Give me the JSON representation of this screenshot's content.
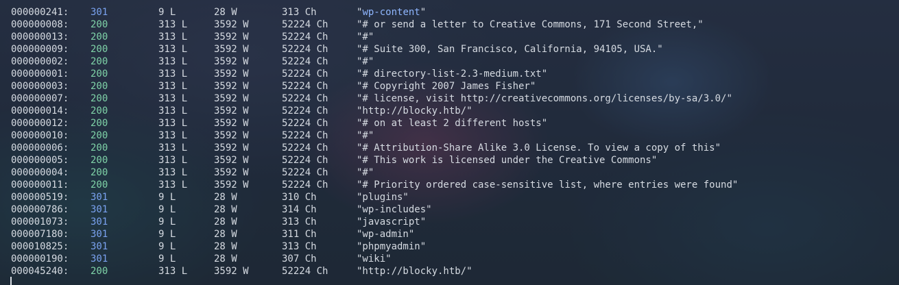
{
  "terminal": {
    "rows": [
      {
        "id": "000000241:",
        "status": "301",
        "lines": "9 L",
        "words": "28 W",
        "chars": "313 Ch",
        "payload_open": "\"",
        "payload_hl": "wp-content",
        "payload_close": "\""
      },
      {
        "id": "000000008:",
        "status": "200",
        "lines": "313 L",
        "words": "3592 W",
        "chars": "52224 Ch",
        "payload": "\"# or send a letter to Creative Commons, 171 Second Street,\""
      },
      {
        "id": "000000013:",
        "status": "200",
        "lines": "313 L",
        "words": "3592 W",
        "chars": "52224 Ch",
        "payload": "\"#\""
      },
      {
        "id": "000000009:",
        "status": "200",
        "lines": "313 L",
        "words": "3592 W",
        "chars": "52224 Ch",
        "payload": "\"# Suite 300, San Francisco, California, 94105, USA.\""
      },
      {
        "id": "000000002:",
        "status": "200",
        "lines": "313 L",
        "words": "3592 W",
        "chars": "52224 Ch",
        "payload": "\"#\""
      },
      {
        "id": "000000001:",
        "status": "200",
        "lines": "313 L",
        "words": "3592 W",
        "chars": "52224 Ch",
        "payload": "\"# directory-list-2.3-medium.txt\""
      },
      {
        "id": "000000003:",
        "status": "200",
        "lines": "313 L",
        "words": "3592 W",
        "chars": "52224 Ch",
        "payload": "\"# Copyright 2007 James Fisher\""
      },
      {
        "id": "000000007:",
        "status": "200",
        "lines": "313 L",
        "words": "3592 W",
        "chars": "52224 Ch",
        "payload": "\"# license, visit http://creativecommons.org/licenses/by-sa/3.0/\""
      },
      {
        "id": "000000014:",
        "status": "200",
        "lines": "313 L",
        "words": "3592 W",
        "chars": "52224 Ch",
        "payload": "\"http://blocky.htb/\""
      },
      {
        "id": "000000012:",
        "status": "200",
        "lines": "313 L",
        "words": "3592 W",
        "chars": "52224 Ch",
        "payload": "\"# on at least 2 different hosts\""
      },
      {
        "id": "000000010:",
        "status": "200",
        "lines": "313 L",
        "words": "3592 W",
        "chars": "52224 Ch",
        "payload": "\"#\""
      },
      {
        "id": "000000006:",
        "status": "200",
        "lines": "313 L",
        "words": "3592 W",
        "chars": "52224 Ch",
        "payload": "\"# Attribution-Share Alike 3.0 License. To view a copy of this\""
      },
      {
        "id": "000000005:",
        "status": "200",
        "lines": "313 L",
        "words": "3592 W",
        "chars": "52224 Ch",
        "payload": "\"# This work is licensed under the Creative Commons\""
      },
      {
        "id": "000000004:",
        "status": "200",
        "lines": "313 L",
        "words": "3592 W",
        "chars": "52224 Ch",
        "payload": "\"#\""
      },
      {
        "id": "000000011:",
        "status": "200",
        "lines": "313 L",
        "words": "3592 W",
        "chars": "52224 Ch",
        "payload": "\"# Priority ordered case-sensitive list, where entries were found\""
      },
      {
        "id": "000000519:",
        "status": "301",
        "lines": "9 L",
        "words": "28 W",
        "chars": "310 Ch",
        "payload": "\"plugins\""
      },
      {
        "id": "000000786:",
        "status": "301",
        "lines": "9 L",
        "words": "28 W",
        "chars": "314 Ch",
        "payload": "\"wp-includes\""
      },
      {
        "id": "000001073:",
        "status": "301",
        "lines": "9 L",
        "words": "28 W",
        "chars": "313 Ch",
        "payload": "\"javascript\""
      },
      {
        "id": "000007180:",
        "status": "301",
        "lines": "9 L",
        "words": "28 W",
        "chars": "311 Ch",
        "payload": "\"wp-admin\""
      },
      {
        "id": "000010825:",
        "status": "301",
        "lines": "9 L",
        "words": "28 W",
        "chars": "313 Ch",
        "payload": "\"phpmyadmin\""
      },
      {
        "id": "000000190:",
        "status": "301",
        "lines": "9 L",
        "words": "28 W",
        "chars": "307 Ch",
        "payload": "\"wiki\""
      },
      {
        "id": "000045240:",
        "status": "200",
        "lines": "313 L",
        "words": "3592 W",
        "chars": "52224 Ch",
        "payload": "\"http://blocky.htb/\""
      }
    ]
  },
  "colors": {
    "status_301": "#7aa2f0",
    "status_200": "#7fd3a8",
    "text": "#d6dbe2",
    "highlight": "#8fb6ff"
  }
}
